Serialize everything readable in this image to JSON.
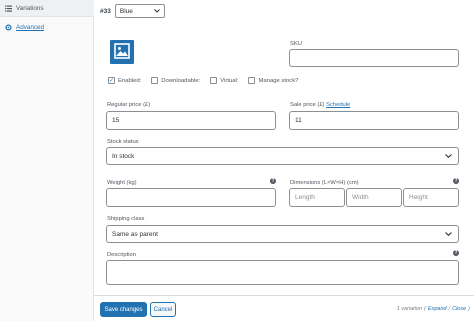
{
  "sidebar": {
    "items": [
      {
        "label": "Variations",
        "icon": "list-icon"
      },
      {
        "label": "Advanced",
        "icon": "gear-icon"
      }
    ]
  },
  "variation": {
    "number": "#33",
    "attribute_value": "Blue"
  },
  "fields": {
    "sku": {
      "label": "SKU",
      "value": ""
    },
    "enabled": {
      "label": "Enabled:",
      "checked": true
    },
    "downloadable": {
      "label": "Downloadable:",
      "checked": false
    },
    "virtual": {
      "label": "Virtual:",
      "checked": false
    },
    "manage_stock": {
      "label": "Manage stock?",
      "checked": false
    },
    "regular_price": {
      "label": "Regular price (£)",
      "value": "15"
    },
    "sale_price": {
      "label": "Sale price (£)",
      "schedule_link": "Schedule",
      "value": "11"
    },
    "stock_status": {
      "label": "Stock status",
      "value": "In stock"
    },
    "weight": {
      "label": "Weight (kg)",
      "value": ""
    },
    "dimensions": {
      "label": "Dimensions (L×W×H) (cm)",
      "length_placeholder": "Length",
      "width_placeholder": "Width",
      "height_placeholder": "Height"
    },
    "shipping_class": {
      "label": "Shipping class",
      "value": "Same as parent"
    },
    "description": {
      "label": "Description",
      "value": ""
    }
  },
  "footer": {
    "save_label": "Save changes",
    "cancel_label": "Cancel",
    "variation_count": "1 variation",
    "expand_label": "Expand",
    "close_label": "Close"
  },
  "colors": {
    "accent": "#2271b1",
    "border": "#8c8f94",
    "text": "#3c434a"
  }
}
